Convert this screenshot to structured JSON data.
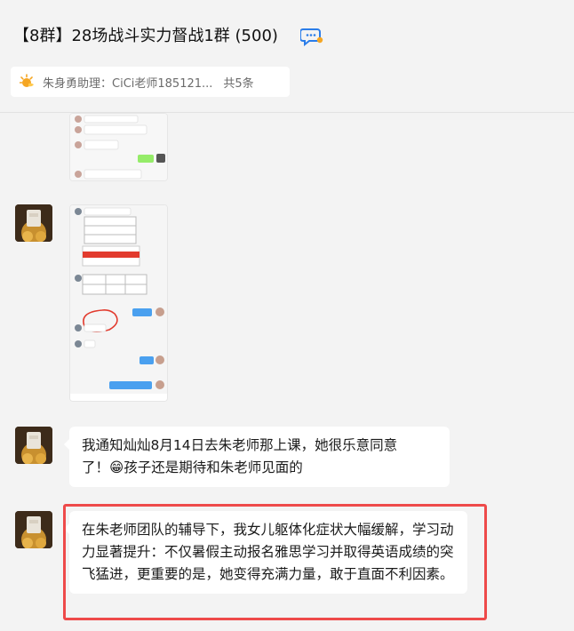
{
  "header": {
    "title": "【8群】28场战斗实力督战1群 (500)",
    "chat_icon": "chat-bubble-icon"
  },
  "notice": {
    "icon": "sun-notice-icon",
    "text": "朱身勇助理：CiCi老师185121...",
    "count": "共5条"
  },
  "messages": [
    {
      "type": "image",
      "avatar": "avatar",
      "content": "screenshot-chat-1"
    },
    {
      "type": "image",
      "avatar": "avatar",
      "content": "screenshot-chat-2"
    },
    {
      "type": "text",
      "avatar": "avatar",
      "line1": "我通知灿灿8月14日去朱老师那上课，她很乐意同意",
      "line2_pre": "了！",
      "emoji": "😁",
      "line2_post": "孩子还是期待和朱老师见面的"
    },
    {
      "type": "text",
      "avatar": "avatar",
      "text": "在朱老师团队的辅导下，我女儿躯体化症状大幅缓解，学习动力显著提升：不仅暑假主动报名雅思学习并取得英语成绩的突飞猛进，更重要的是，她变得充满力量，敢于直面不利因素。"
    }
  ],
  "colors": {
    "background": "#f3f3f3",
    "bubble": "#ffffff",
    "highlight": "#ee4a4a",
    "notice_icon": "#f5a623"
  }
}
